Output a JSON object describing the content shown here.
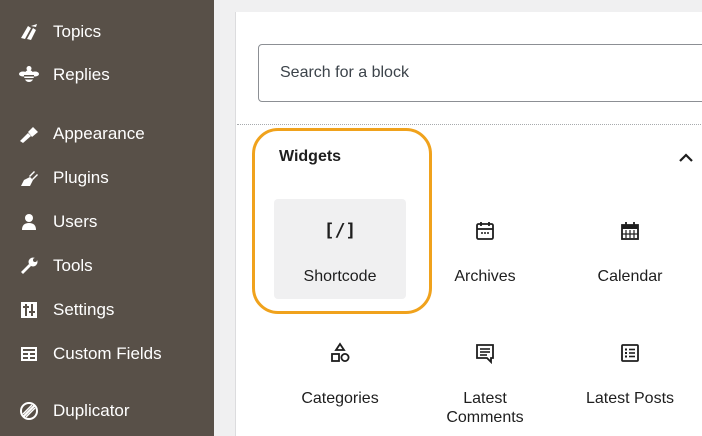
{
  "sidebar": {
    "items": [
      {
        "label": "Topics",
        "icon": "topics-icon"
      },
      {
        "label": "Replies",
        "icon": "replies-icon"
      },
      {
        "label": "Appearance",
        "icon": "appearance-icon"
      },
      {
        "label": "Plugins",
        "icon": "plugins-icon"
      },
      {
        "label": "Users",
        "icon": "users-icon"
      },
      {
        "label": "Tools",
        "icon": "tools-icon"
      },
      {
        "label": "Settings",
        "icon": "settings-icon"
      },
      {
        "label": "Custom Fields",
        "icon": "custom-fields-icon"
      },
      {
        "label": "Duplicator",
        "icon": "duplicator-icon"
      }
    ]
  },
  "inserter": {
    "search": {
      "placeholder": "Search for a block",
      "value": ""
    },
    "section": {
      "title": "Widgets",
      "collapse_icon": "chevron-up-icon"
    },
    "blocks": [
      {
        "label": "Shortcode",
        "icon": "shortcode-icon",
        "glyph": "[/]",
        "selected": true
      },
      {
        "label": "Archives",
        "icon": "archives-icon"
      },
      {
        "label": "Calendar",
        "icon": "calendar-icon"
      },
      {
        "label": "Categories",
        "icon": "categories-icon"
      },
      {
        "label": "Latest Comments",
        "icon": "latest-comments-icon"
      },
      {
        "label": "Latest Posts",
        "icon": "latest-posts-icon"
      }
    ]
  },
  "colors": {
    "sidebar_bg": "#585048",
    "highlight": "#f0a21c",
    "text": "#1e1e1e"
  }
}
